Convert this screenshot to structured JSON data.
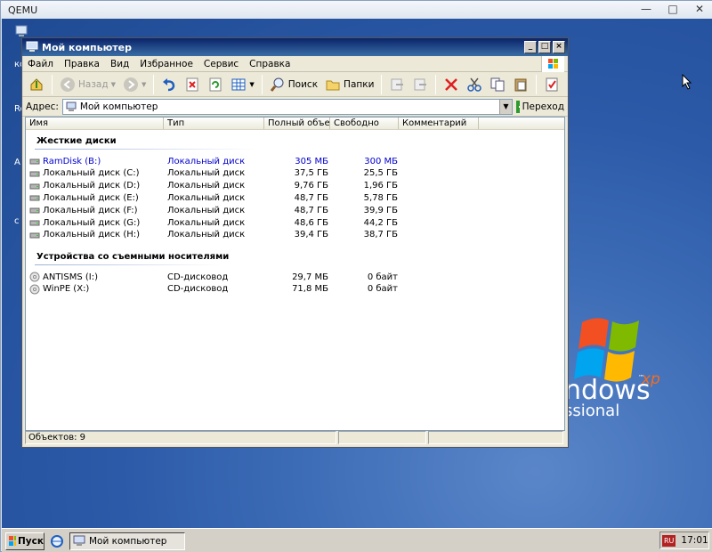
{
  "host": {
    "title": "QEMU",
    "min": "—",
    "max": "□",
    "close": "✕"
  },
  "desktop": {
    "partial_labels": [
      "ко",
      "Re",
      "А",
      "с"
    ],
    "xp_word": "ndows",
    "xp_sup": "xp",
    "xp_edition": "ssional"
  },
  "window": {
    "title": "Мой компьютер",
    "menu": [
      "Файл",
      "Правка",
      "Вид",
      "Избранное",
      "Сервис",
      "Справка"
    ],
    "toolbar": {
      "back": "Назад",
      "search": "Поиск",
      "folders": "Папки"
    },
    "address_label": "Адрес:",
    "address_value": "Мой компьютер",
    "go_label": "Переход",
    "columns": [
      "Имя",
      "Тип",
      "Полный объем",
      "Свободно",
      "Комментарий"
    ],
    "groups": {
      "hard": "Жесткие диски",
      "removable": "Устройства со съемными носителями"
    },
    "hard_disks": [
      {
        "name": "RamDisk (B:)",
        "type": "Локальный диск",
        "total": "305 МБ",
        "free": "300 МБ",
        "selected": true
      },
      {
        "name": "Локальный диск (C:)",
        "type": "Локальный диск",
        "total": "37,5 ГБ",
        "free": "25,5 ГБ"
      },
      {
        "name": "Локальный диск (D:)",
        "type": "Локальный диск",
        "total": "9,76 ГБ",
        "free": "1,96 ГБ"
      },
      {
        "name": "Локальный диск (E:)",
        "type": "Локальный диск",
        "total": "48,7 ГБ",
        "free": "5,78 ГБ"
      },
      {
        "name": "Локальный диск (F:)",
        "type": "Локальный диск",
        "total": "48,7 ГБ",
        "free": "39,9 ГБ"
      },
      {
        "name": "Локальный диск (G:)",
        "type": "Локальный диск",
        "total": "48,6 ГБ",
        "free": "44,2 ГБ"
      },
      {
        "name": "Локальный диск (H:)",
        "type": "Локальный диск",
        "total": "39,4 ГБ",
        "free": "38,7 ГБ"
      }
    ],
    "removable": [
      {
        "name": "ANTISMS (I:)",
        "type": "CD-дисковод",
        "total": "29,7 МБ",
        "free": "0 байт"
      },
      {
        "name": "WinPE (X:)",
        "type": "CD-дисковод",
        "total": "71,8 МБ",
        "free": "0 байт"
      }
    ],
    "status": "Объектов: 9"
  },
  "taskbar": {
    "start": "Пуск",
    "task": "Мой компьютер",
    "lang": "RU",
    "clock": "17:01"
  },
  "colors": {
    "title_start": "#0a246a",
    "title_end": "#3a6ea5",
    "selected_text": "#0000cc"
  }
}
